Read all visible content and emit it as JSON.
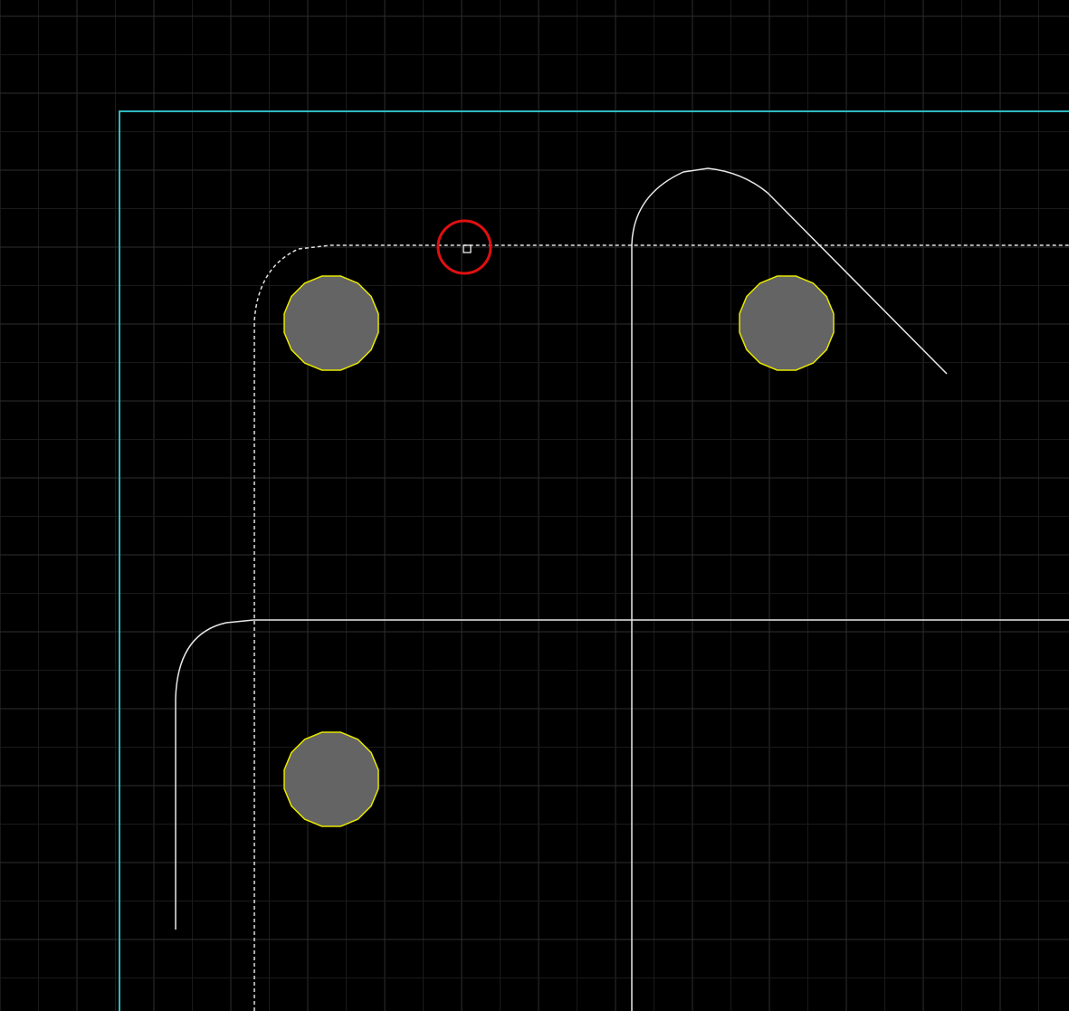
{
  "view": {
    "kind": "cad-canvas",
    "background_color": "#000000"
  },
  "colors": {
    "grid_minor": "#1a1a1a",
    "grid_major": "#2e2e2e",
    "board_edge": "#2fb8c2",
    "outline": "#e8e8e8",
    "keepout": "#e0e0e0",
    "pad_fill": "#646464",
    "pad_stroke": "#e6e600",
    "marker": "#e01010"
  },
  "elements": {
    "pads": [
      {
        "id": "pad-1",
        "shape": "circle"
      },
      {
        "id": "pad-2",
        "shape": "circle"
      },
      {
        "id": "pad-3",
        "shape": "circle"
      }
    ],
    "marker": {
      "icon": "red-circle-marker"
    },
    "snap_point": {
      "icon": "small-square-icon"
    }
  }
}
